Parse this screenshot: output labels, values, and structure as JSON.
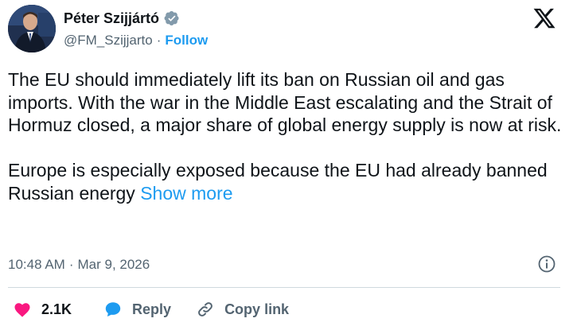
{
  "author": {
    "name": "Péter Szijjártó",
    "handle": "@FM_Szijjarto",
    "separator": "·",
    "follow_label": "Follow",
    "verified_badge": "gray-check-icon",
    "avatar": "avatar-photo"
  },
  "platform_logo": "x-logo-icon",
  "tweet": {
    "paragraph1": "The EU should immediately lift its ban on Russian oil and gas imports. With the war in the Middle East escalating and the Strait of Hormuz closed, a major share of global energy supply is now at risk.",
    "paragraph2_text": "Europe is especially exposed because the EU had already banned Russian energy",
    "show_more_label": "Show more"
  },
  "meta": {
    "time": "10:48 AM",
    "separator": "·",
    "date": "Mar 9, 2026",
    "info_icon": "info-icon"
  },
  "actions": {
    "like_count": "2.1K",
    "reply_label": "Reply",
    "copy_link_label": "Copy link"
  },
  "colors": {
    "link": "#1d9bf0",
    "like": "#f91880",
    "text": "#0f1419",
    "muted": "#536471",
    "divider": "#cfd9de"
  }
}
